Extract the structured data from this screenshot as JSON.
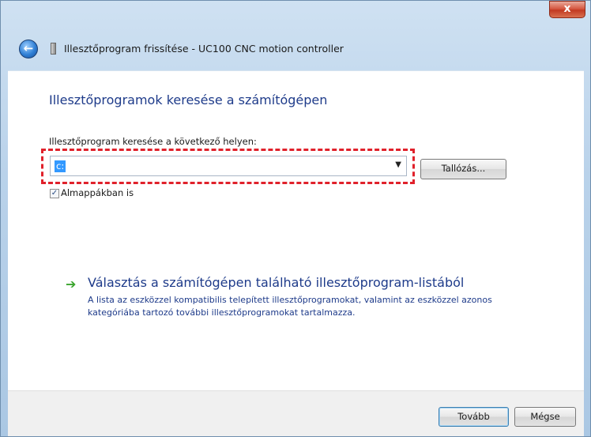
{
  "window": {
    "title": "Illesztőprogram frissítése - UC100 CNC motion controller",
    "close_label": "x"
  },
  "main": {
    "heading": "Illesztőprogramok keresése a számítógépen",
    "location_label": "Illesztőprogram keresése a következő helyen:",
    "location_value": "c:",
    "browse_label": "Tallózás...",
    "subfolder_label": "Almappákban is",
    "subfolder_checked": true,
    "choose_title": "Választás a számítógépen található illesztőprogram-listából",
    "choose_desc": "A lista az eszközzel kompatibilis telepített illesztőprogramokat, valamint az eszközzel azonos kategóriába tartozó további illesztőprogramokat tartalmazza."
  },
  "footer": {
    "next_label": "Tovább",
    "cancel_label": "Mégse"
  },
  "icons": {
    "back": "back-arrow-icon",
    "device": "device-icon",
    "choose": "green-arrow-icon",
    "dropdown": "chevron-down-icon"
  },
  "colors": {
    "heading": "#1e3b8a",
    "highlight": "#e0212b",
    "selection": "#3399ff"
  }
}
